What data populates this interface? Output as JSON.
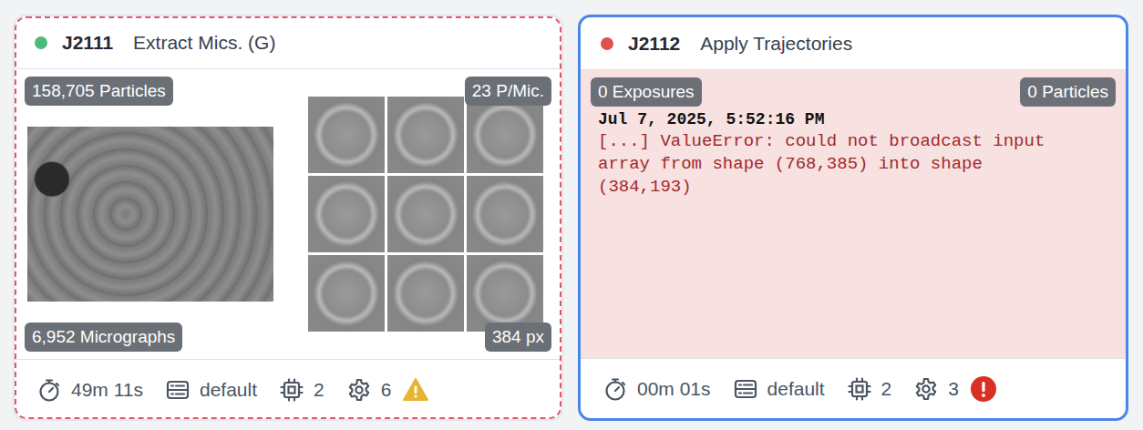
{
  "jobs": [
    {
      "id": "J2111",
      "title": "Extract Mics. (G)",
      "color": "#4cba7d",
      "selected": false,
      "highlighted": true,
      "kind": "preview",
      "badges": {
        "top_left": "158,705 Particles",
        "top_right": "23 P/Mic.",
        "bottom_left": "6,952 Micrographs",
        "bottom_right": "384 px"
      },
      "runtime": "49m 11s",
      "lane": "default",
      "gpus": "2",
      "params": "6",
      "alert": "warning"
    },
    {
      "id": "J2112",
      "title": "Apply Trajectories",
      "color": "#e0504f",
      "selected": true,
      "highlighted": false,
      "kind": "error",
      "badges": {
        "top_left": "0 Exposures",
        "top_right": "0 Particles"
      },
      "log_time": "Jul 7, 2025, 5:52:16 PM",
      "log_message": "[...] ValueError: could not broadcast input array from shape (768,385) into shape (384,193)",
      "runtime": "00m 01s",
      "lane": "default",
      "gpus": "2",
      "params": "3",
      "alert": "error"
    }
  ]
}
